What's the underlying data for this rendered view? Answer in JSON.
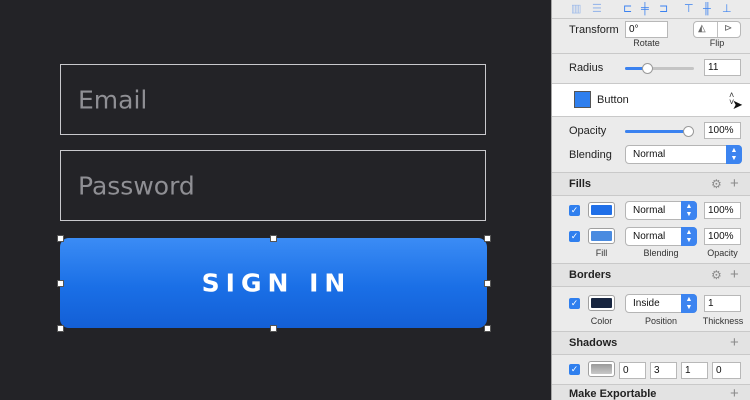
{
  "canvas": {
    "email_placeholder": "Email",
    "password_placeholder": "Password",
    "button_label": "SIGN IN"
  },
  "inspector": {
    "transform": {
      "label": "Transform",
      "rotate_value": "0°",
      "rotate_label": "Rotate",
      "flip_label": "Flip"
    },
    "radius": {
      "label": "Radius",
      "value": "11",
      "level": 0.3
    },
    "style": {
      "name": "Button",
      "color": "#2f7fee"
    },
    "opacity": {
      "label": "Opacity",
      "value": "100%",
      "level": 1.0
    },
    "blending": {
      "label": "Blending",
      "value": "Normal"
    },
    "fills": {
      "title": "Fills",
      "items": [
        {
          "color": "#1f6fe8",
          "blending": "Normal",
          "opacity": "100%"
        },
        {
          "color": "#4a8be0",
          "blending": "Normal",
          "opacity": "100%"
        }
      ],
      "col_fill": "Fill",
      "col_blending": "Blending",
      "col_opacity": "Opacity"
    },
    "borders": {
      "title": "Borders",
      "color": "#172540",
      "position": "Inside",
      "thickness": "1",
      "col_color": "Color",
      "col_position": "Position",
      "col_thickness": "Thickness"
    },
    "shadows": {
      "title": "Shadows",
      "x": "0",
      "y": "3",
      "blur": "1",
      "spread": "0"
    },
    "export": {
      "title": "Make Exportable"
    }
  }
}
